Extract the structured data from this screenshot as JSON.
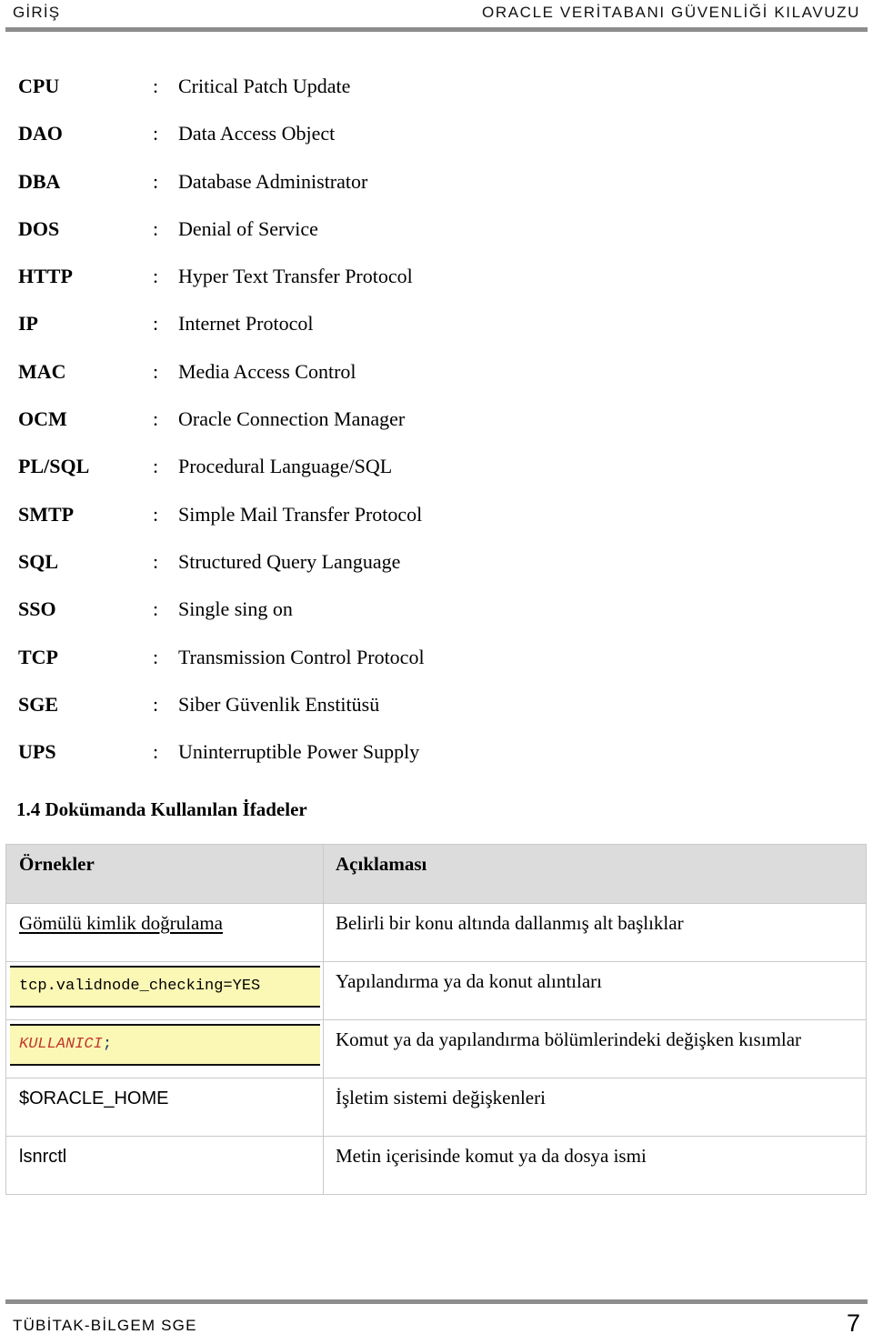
{
  "header": {
    "left_text": "GİRİŞ",
    "right_text": "ORACLE VERİTABANI GÜVENLİĞİ KILAVUZU"
  },
  "abbreviations": {
    "separator": ":",
    "items": [
      {
        "term": "CPU",
        "definition": "Critical Patch Update"
      },
      {
        "term": "DAO",
        "definition": "Data Access Object"
      },
      {
        "term": "DBA",
        "definition": "Database Administrator"
      },
      {
        "term": "DOS",
        "definition": "Denial of Service"
      },
      {
        "term": "HTTP",
        "definition": "Hyper Text Transfer Protocol"
      },
      {
        "term": "IP",
        "definition": "Internet Protocol"
      },
      {
        "term": "MAC",
        "definition": "Media Access Control"
      },
      {
        "term": "OCM",
        "definition": "Oracle Connection Manager"
      },
      {
        "term": "PL/SQL",
        "definition": "Procedural Language/SQL"
      },
      {
        "term": "SMTP",
        "definition": "Simple Mail Transfer Protocol"
      },
      {
        "term": "SQL",
        "definition": "Structured Query Language"
      },
      {
        "term": "SSO",
        "definition": "Single sing on"
      },
      {
        "term": "TCP",
        "definition": "Transmission Control Protocol"
      },
      {
        "term": "SGE",
        "definition": "Siber Güvenlik Enstitüsü"
      },
      {
        "term": "UPS",
        "definition": "Uninterruptible Power Supply"
      }
    ]
  },
  "section": {
    "heading": "1.4 Dokümanda Kullanılan İfadeler"
  },
  "conventions_table": {
    "columns": [
      "Örnekler",
      "Açıklaması"
    ],
    "rows": [
      {
        "example": "Gömülü kimlik doğrulama",
        "style": "underline",
        "description": "Belirli bir konu altında dallanmış alt başlıklar"
      },
      {
        "example": "tcp.validnode_checking=YES",
        "style": "code-highlight",
        "description": "Yapılandırma ya da konut alıntıları"
      },
      {
        "example": "KULLANICI;",
        "example_variable": "KULLANICI",
        "example_punct": ";",
        "style": "code-highlight-variable",
        "description": "Komut ya da yapılandırma bölümlerindeki değişken kısımlar"
      },
      {
        "example": "$ORACLE_HOME",
        "style": "sans",
        "description": "İşletim sistemi değişkenleri"
      },
      {
        "example": "lsnrctl",
        "style": "sans",
        "description": "Metin içerisinde komut ya da dosya ismi"
      }
    ]
  },
  "footer": {
    "left_text": "TÜBİTAK-BİLGEM SGE",
    "page_number": "7"
  },
  "colors": {
    "rule": "#8d8d8d",
    "table_header_bg": "#dcdcdc",
    "code_highlight_bg": "#fbf7b5",
    "code_variable": "#c0392b",
    "code_punct": "#1f3864"
  }
}
